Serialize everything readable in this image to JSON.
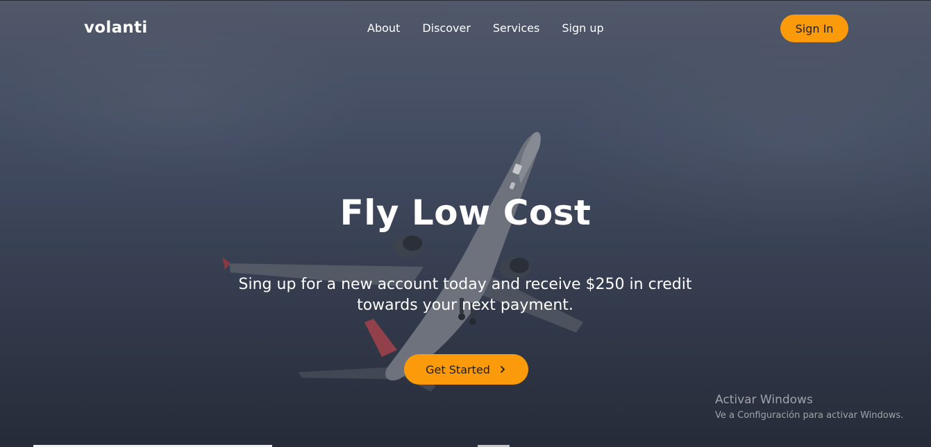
{
  "brand": {
    "name": "volanti"
  },
  "nav": {
    "items": [
      {
        "label": "About"
      },
      {
        "label": "Discover"
      },
      {
        "label": "Services"
      },
      {
        "label": "Sign up"
      }
    ],
    "signin_label": "Sign In"
  },
  "hero": {
    "title": "Fly Low Cost",
    "subtitle": "Sing up for a new account today and receive $250 in credit towards your next payment.",
    "cta_label": "Get Started",
    "cta_icon": "chevron-right-icon",
    "background_image": "airplane-in-sky"
  },
  "watermark": {
    "title": "Activar Windows",
    "subtitle": "Ve a Configuración para activar Windows."
  },
  "colors": {
    "accent": "#fb9a0a",
    "text_on_accent": "#1d1d1d",
    "text_light": "#ffffff",
    "background": "#4c566d"
  }
}
